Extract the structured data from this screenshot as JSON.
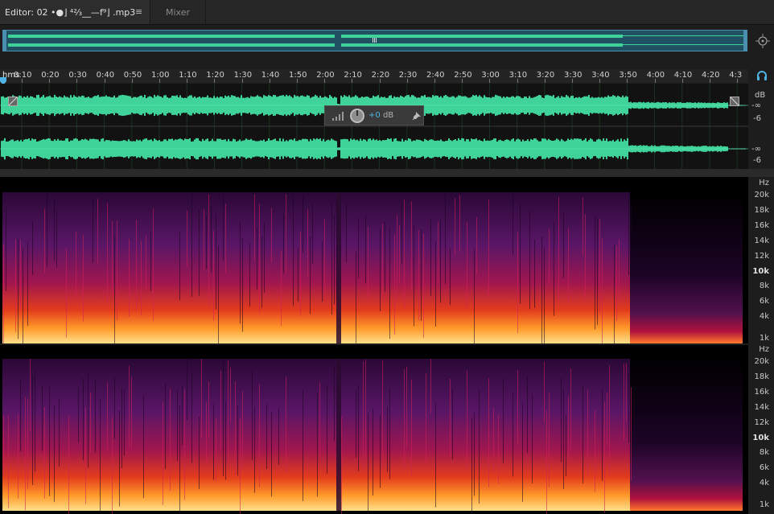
{
  "tabs": {
    "editor_label": "Editor: 02 •●⌋ ⁴⅔__—f⁹⌋ .mp3",
    "menu_icon": "≡",
    "mixer_label": "Mixer"
  },
  "ruler": {
    "unit": "hms",
    "ticks": [
      "0:10",
      "0:20",
      "0:30",
      "0:40",
      "0:50",
      "1:00",
      "1:10",
      "1:20",
      "1:30",
      "1:40",
      "1:50",
      "2:00",
      "2:10",
      "2:20",
      "2:30",
      "2:40",
      "2:50",
      "3:00",
      "3:10",
      "3:20",
      "3:30",
      "3:40",
      "3:50",
      "4:00",
      "4:10",
      "4:20",
      "4:3"
    ]
  },
  "waveform_scale": {
    "unit": "dB",
    "ch1": [
      "-∞",
      "-6"
    ],
    "ch2": [
      "-∞",
      "-6"
    ]
  },
  "hud": {
    "value": "+0",
    "unit": "dB"
  },
  "spectral_scale": {
    "unit": "Hz",
    "labels": [
      "20k",
      "18k",
      "16k",
      "14k",
      "12k",
      "10k",
      "8k",
      "6k",
      "4k",
      "1k"
    ],
    "major": [
      "10k"
    ]
  },
  "colors": {
    "waveform": "#3fd39a",
    "overview_bg": "#1f5163",
    "accent": "#4fb3e6",
    "spectral_low": "#3a0f4a",
    "spectral_mid": "#c2154a",
    "spectral_high": "#ffd36a"
  },
  "icons": {
    "zoom": "zoom-target-icon",
    "headphones": "headphones-icon",
    "pin": "pin-icon",
    "knob": "volume-knob-icon"
  }
}
